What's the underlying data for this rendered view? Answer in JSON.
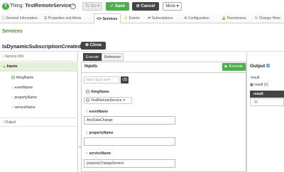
{
  "header": {
    "thing_icon": "thing-icon",
    "thing_label": "Thing:",
    "thing_name": "TestRemoteService",
    "todo_label": "To Do",
    "save_label": "Save",
    "cancel_label": "Cancel",
    "more_label": "More"
  },
  "tabs": [
    {
      "label": "General Information",
      "icon": "info-icon",
      "active": false
    },
    {
      "label": "Properties and Alerts",
      "icon": "list-icon",
      "active": false
    },
    {
      "label": "Services",
      "icon": "code-icon",
      "active": true
    },
    {
      "label": "Events",
      "icon": "lightning-icon",
      "active": false
    },
    {
      "label": "Subscriptions",
      "icon": "subscription-icon",
      "active": false
    },
    {
      "label": "Configuration",
      "icon": "gear-icon",
      "active": false
    },
    {
      "label": "Permissions",
      "icon": "lock-icon",
      "active": false
    },
    {
      "label": "Change Histo",
      "icon": "history-icon",
      "active": false
    }
  ],
  "section_title": "Services",
  "service_name": "IsDynamicSubscriptionCreated",
  "close_label": "Close",
  "left": {
    "service_info": "Service Info",
    "inputs": "Inputs",
    "params": [
      "thingName",
      "eventName",
      "propertyName",
      "serviceName"
    ],
    "output": "Output"
  },
  "exec_tabs": {
    "execute": "Execute",
    "reference": "Reference"
  },
  "panel": {
    "inputs_title": "Inputs",
    "execute_label": "Execute",
    "select_input_placeholder": "Select input set",
    "fields": {
      "thingName": {
        "label": "thingName",
        "value": "TestRemoteService"
      },
      "eventName": {
        "label": "eventName",
        "value": "AnyDataChange"
      },
      "propertyName": {
        "label": "propertyName",
        "value": ""
      },
      "serviceName": {
        "label": "serviceName",
        "value": "propertyChangeService"
      }
    }
  },
  "output": {
    "title": "Output",
    "result_label": "result",
    "result_count": "result (1)",
    "column": "result"
  },
  "colors": {
    "accent_green": "#4cae4c",
    "dark": "#444444",
    "section_green": "#4c8a2c"
  }
}
